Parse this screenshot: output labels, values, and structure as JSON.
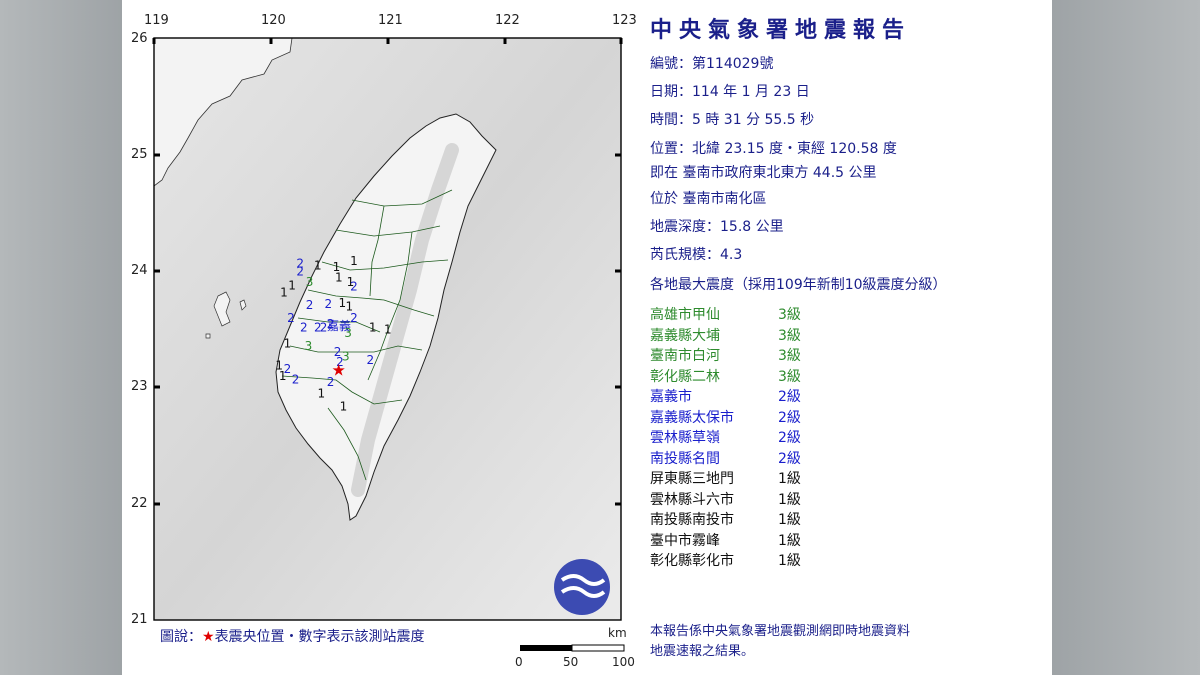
{
  "report": {
    "title": "中央氣象署地震報告",
    "number_label": "編號：",
    "number_value": "第114029號",
    "date_label": "日期：",
    "date_value": "114 年 1 月 23 日",
    "time_label": "時間：",
    "time_value": "5 時 31 分 55.5 秒",
    "position_label": "位置：",
    "position_value": "北緯 23.15 度・東經 120.58 度",
    "relative_location": "即在 臺南市政府東北東方 44.5 公里",
    "district": "位於 臺南市南化區",
    "depth_label": "地震深度：",
    "depth_value": "15.8 公里",
    "magnitude_label": "芮氏規模：",
    "magnitude_value": "4.3",
    "intensity_heading": "各地最大震度（採用109年新制10級震度分級）",
    "intensities": [
      {
        "location": "高雄市甲仙",
        "level": "3級",
        "class": "lvl3"
      },
      {
        "location": "嘉義縣大埔",
        "level": "3級",
        "class": "lvl3"
      },
      {
        "location": "臺南市白河",
        "level": "3級",
        "class": "lvl3"
      },
      {
        "location": "彰化縣二林",
        "level": "3級",
        "class": "lvl3"
      },
      {
        "location": "嘉義市",
        "level": "2級",
        "class": "lvl2"
      },
      {
        "location": "嘉義縣太保市",
        "level": "2級",
        "class": "lvl2"
      },
      {
        "location": "雲林縣草嶺",
        "level": "2級",
        "class": "lvl2"
      },
      {
        "location": "南投縣名間",
        "level": "2級",
        "class": "lvl2"
      },
      {
        "location": "屏東縣三地門",
        "level": "1級",
        "class": "lvl1"
      },
      {
        "location": "雲林縣斗六市",
        "level": "1級",
        "class": "lvl1"
      },
      {
        "location": "南投縣南投市",
        "level": "1級",
        "class": "lvl1"
      },
      {
        "location": "臺中市霧峰",
        "level": "1級",
        "class": "lvl1"
      },
      {
        "location": "彰化縣彰化市",
        "level": "1級",
        "class": "lvl1"
      }
    ],
    "footer_line1": "本報告係中央氣象署地震觀測網即時地震資料",
    "footer_line2": "地震速報之結果。"
  },
  "map": {
    "lon_ticks": [
      "119",
      "120",
      "121",
      "122",
      "123"
    ],
    "lat_ticks": [
      "26",
      "25",
      "24",
      "23",
      "22",
      "21"
    ],
    "legend_prefix": "圖說：",
    "legend_star": "★",
    "legend_text": "表震央位置・數字表示該測站震度",
    "scale_unit": "km",
    "scale_labels": [
      "0",
      "50",
      "100"
    ],
    "city_label": "嘉義",
    "epicenter": {
      "lon": 120.58,
      "lat": 23.15
    },
    "stations": [
      {
        "v": "2",
        "lon": 120.22,
        "lat": 24.03,
        "c": "lvl2"
      },
      {
        "v": "1",
        "lon": 120.37,
        "lat": 24.01,
        "c": "lvl1"
      },
      {
        "v": "1",
        "lon": 120.53,
        "lat": 24.0,
        "c": "lvl1"
      },
      {
        "v": "1",
        "lon": 120.68,
        "lat": 24.05,
        "c": "lvl1"
      },
      {
        "v": "2",
        "lon": 120.22,
        "lat": 23.96,
        "c": "lvl2"
      },
      {
        "v": "1",
        "lon": 120.55,
        "lat": 23.91,
        "c": "lvl1"
      },
      {
        "v": "3",
        "lon": 120.3,
        "lat": 23.87,
        "c": "lvl3"
      },
      {
        "v": "1",
        "lon": 120.65,
        "lat": 23.87,
        "c": "lvl1"
      },
      {
        "v": "2",
        "lon": 120.68,
        "lat": 23.83,
        "c": "lvl2"
      },
      {
        "v": "1",
        "lon": 120.15,
        "lat": 23.84,
        "c": "lvl1"
      },
      {
        "v": "1",
        "lon": 120.08,
        "lat": 23.78,
        "c": "lvl1"
      },
      {
        "v": "2",
        "lon": 120.3,
        "lat": 23.67,
        "c": "lvl2"
      },
      {
        "v": "2",
        "lon": 120.46,
        "lat": 23.68,
        "c": "lvl2"
      },
      {
        "v": "1",
        "lon": 120.58,
        "lat": 23.69,
        "c": "lvl1"
      },
      {
        "v": "1",
        "lon": 120.64,
        "lat": 23.66,
        "c": "lvl1"
      },
      {
        "v": "2",
        "lon": 120.14,
        "lat": 23.56,
        "c": "lvl2"
      },
      {
        "v": "2",
        "lon": 120.68,
        "lat": 23.56,
        "c": "lvl2"
      },
      {
        "v": "2",
        "lon": 120.48,
        "lat": 23.51,
        "c": "lvl2"
      },
      {
        "v": "2",
        "lon": 120.25,
        "lat": 23.48,
        "c": "lvl2"
      },
      {
        "v": "2",
        "lon": 120.37,
        "lat": 23.48,
        "c": "lvl2"
      },
      {
        "v": "2",
        "lon": 120.42,
        "lat": 23.48,
        "c": "lvl2"
      },
      {
        "v": "1",
        "lon": 120.84,
        "lat": 23.48,
        "c": "lvl1"
      },
      {
        "v": "1",
        "lon": 120.97,
        "lat": 23.46,
        "c": "lvl1"
      },
      {
        "v": "3",
        "lon": 120.63,
        "lat": 23.43,
        "c": "lvl3"
      },
      {
        "v": "1",
        "lon": 120.11,
        "lat": 23.34,
        "c": "lvl1"
      },
      {
        "v": "3",
        "lon": 120.29,
        "lat": 23.32,
        "c": "lvl3"
      },
      {
        "v": "2",
        "lon": 120.54,
        "lat": 23.27,
        "c": "lvl2"
      },
      {
        "v": "3",
        "lon": 120.61,
        "lat": 23.23,
        "c": "lvl3"
      },
      {
        "v": "2",
        "lon": 120.82,
        "lat": 23.2,
        "c": "lvl2"
      },
      {
        "v": "2",
        "lon": 120.56,
        "lat": 23.18,
        "c": "lvl2"
      },
      {
        "v": "1",
        "lon": 120.04,
        "lat": 23.15,
        "c": "lvl1"
      },
      {
        "v": "2",
        "lon": 120.11,
        "lat": 23.12,
        "c": "lvl2"
      },
      {
        "v": "1",
        "lon": 120.07,
        "lat": 23.06,
        "c": "lvl1"
      },
      {
        "v": "2",
        "lon": 120.18,
        "lat": 23.03,
        "c": "lvl2"
      },
      {
        "v": "2",
        "lon": 120.48,
        "lat": 23.01,
        "c": "lvl2"
      },
      {
        "v": "1",
        "lon": 120.4,
        "lat": 22.91,
        "c": "lvl1"
      },
      {
        "v": "1",
        "lon": 120.59,
        "lat": 22.8,
        "c": "lvl1"
      }
    ],
    "colors": {
      "frame": "#000000",
      "land": "#f2f2f2",
      "sea": "#dedede",
      "star": "#e00000"
    }
  }
}
